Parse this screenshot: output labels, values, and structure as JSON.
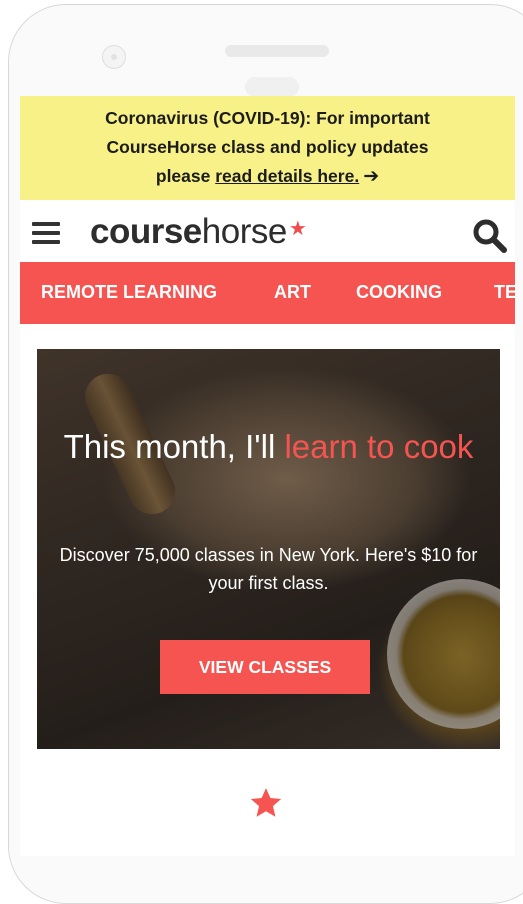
{
  "banner": {
    "line1": "Coronavirus (COVID-19): For important",
    "line2": "CourseHorse class and policy updates",
    "line3_prefix": "please ",
    "link": "read details here.",
    "arrow": "➔"
  },
  "header": {
    "logo_bold": "course",
    "logo_light": "horse",
    "logo_star": "★",
    "menu_icon": "hamburger-menu-icon",
    "search_icon": "search-icon"
  },
  "nav": {
    "items": [
      {
        "label": "REMOTE LEARNING"
      },
      {
        "label": "ART"
      },
      {
        "label": "COOKING"
      },
      {
        "label": "TE"
      }
    ]
  },
  "hero": {
    "title_prefix": "This month, I'll ",
    "title_accent": "learn to cook",
    "subtitle": "Discover 75,000 classes in New York. Here's $10 for your first class.",
    "cta": "VIEW CLASSES"
  },
  "colors": {
    "brand": "#f55451",
    "banner_bg": "#f7f187",
    "text_dark": "#2d2d2d"
  }
}
